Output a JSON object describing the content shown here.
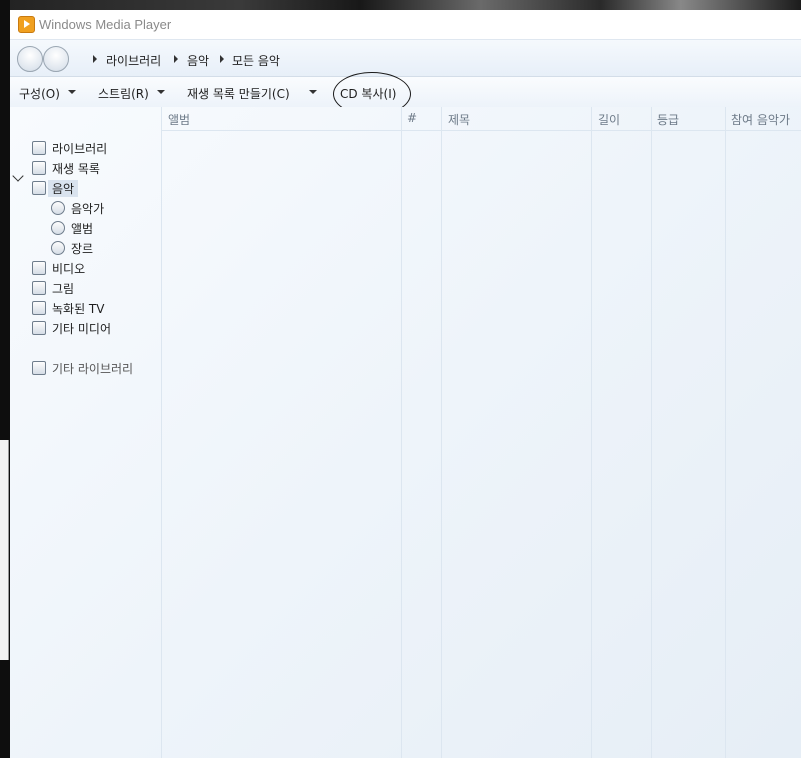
{
  "window": {
    "title": "Windows Media Player"
  },
  "breadcrumb": [
    "라이브러리",
    "음악",
    "모든 음악"
  ],
  "toolbar": {
    "organize": "구성(O)",
    "stream": "스트림(R)",
    "create_playlist": "재생 목록 만들기(C)",
    "rip_cd": "CD 복사(I)"
  },
  "nav": {
    "library": "라이브러리",
    "playlists": "재생 목록",
    "music": "음악",
    "artist": "음악가",
    "album": "앨범",
    "genre": "장르",
    "video": "비디오",
    "pictures": "그림",
    "recorded_tv": "녹화된 TV",
    "other_media": "기타 미디어",
    "other_libraries": "기타 라이브러리"
  },
  "columns": [
    "앨범",
    "#",
    "제목",
    "길이",
    "등급",
    "참여 음악가"
  ],
  "icons": {
    "app": "media-player-icon",
    "library": "library-icon",
    "playlist": "playlist-icon",
    "music": "music-note-icon",
    "artist": "artist-icon",
    "album": "album-icon",
    "genre": "genre-icon",
    "video": "video-icon",
    "pictures": "picture-icon",
    "recorded_tv": "tv-icon",
    "other_media": "media-icon",
    "other_libraries": "network-library-icon"
  },
  "colors": {
    "accent": "#f0a020",
    "selection": "#d9e3ee",
    "header_text": "#6d7a88"
  }
}
